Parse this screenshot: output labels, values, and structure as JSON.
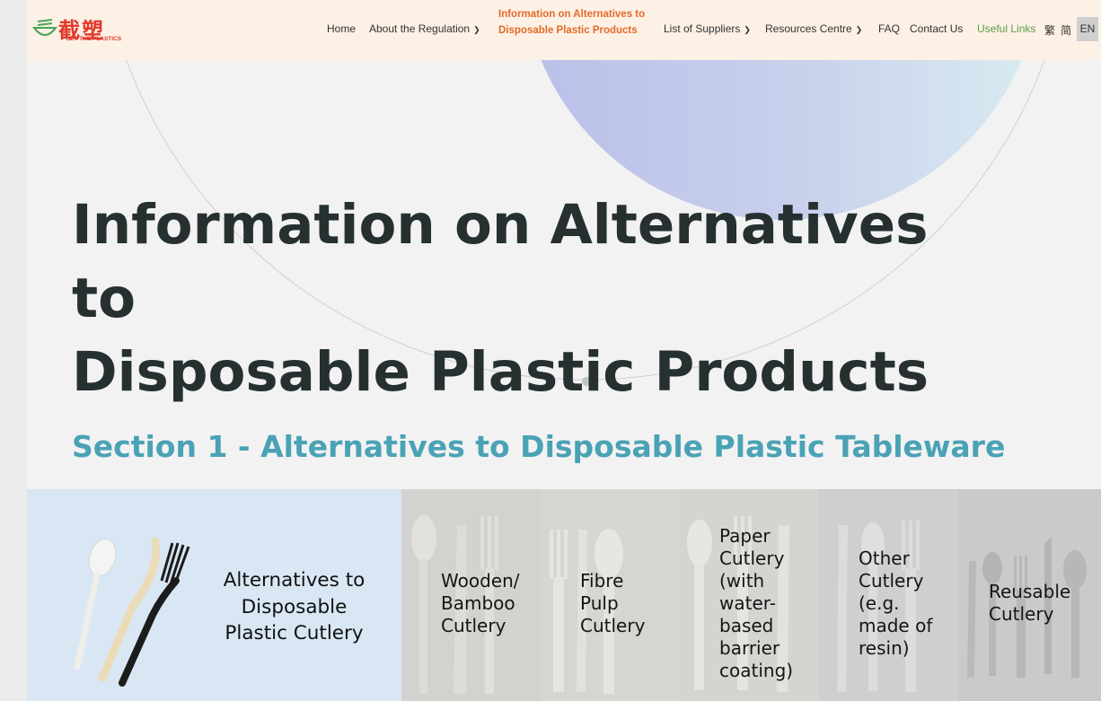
{
  "header": {
    "logo_text": "截塑",
    "logo_subtext": "CUT THE PLASTICS",
    "nav": {
      "home": "Home",
      "about": "About the Regulation",
      "active_line1": "Information on Alternatives to",
      "active_line2": "Disposable Plastic Products",
      "suppliers": "List of Suppliers",
      "resources": "Resources Centre",
      "faq": "FAQ",
      "contact": "Contact Us",
      "useful": "Useful Links"
    },
    "lang": {
      "trad": "繁",
      "simp": "简",
      "en": "EN"
    }
  },
  "hero": {
    "title_line1": "Information on Alternatives to",
    "title_line2": "Disposable Plastic Products"
  },
  "section": {
    "title": "Section 1 - Alternatives to Disposable Plastic Tableware"
  },
  "cards": {
    "main": {
      "line1": "Alternatives to",
      "line2": "Disposable",
      "line3": "Plastic Cutlery"
    },
    "items": [
      {
        "lines": [
          "Wooden/",
          "Bamboo",
          "Cutlery"
        ]
      },
      {
        "lines": [
          "Fibre",
          "Pulp",
          "Cutlery"
        ]
      },
      {
        "lines": [
          "Paper",
          "Cutlery",
          "(with",
          "water-",
          "based",
          "barrier",
          "coating)"
        ]
      },
      {
        "lines": [
          "Other",
          "Cutlery",
          "(e.g.",
          "made of",
          "resin)"
        ]
      },
      {
        "lines": [
          "Reusable",
          "Cutlery"
        ]
      }
    ]
  },
  "colors": {
    "header_bg": "#fdf0e4",
    "active_nav": "#e36a2a",
    "useful_links": "#5aa04a",
    "section_title": "#4aa2b5",
    "card_main_bg": "#d9e7f4"
  }
}
